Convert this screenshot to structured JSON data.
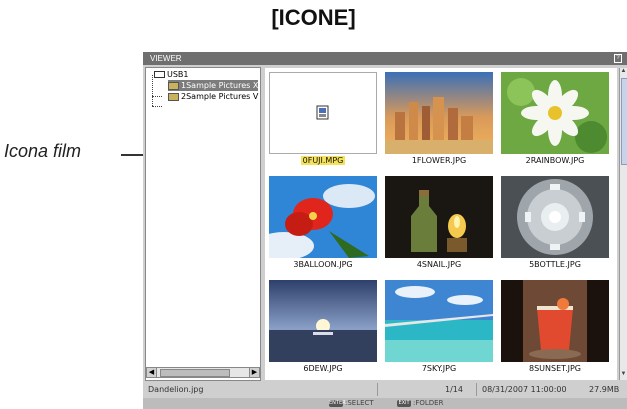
{
  "heading": "[ICONE]",
  "callout": "Icona film",
  "window": {
    "title": "VIEWER",
    "title_icon": "help-icon"
  },
  "tree": {
    "root": "USB1",
    "folders": [
      {
        "label": "1Sample Pictures X",
        "selected": true
      },
      {
        "label": "2Sample Pictures V",
        "selected": false
      }
    ]
  },
  "files": [
    {
      "name": "0FUJI.MPG",
      "kind": "movie",
      "selected": true
    },
    {
      "name": "1FLOWER.JPG",
      "kind": "city-skyline"
    },
    {
      "name": "2RAINBOW.JPG",
      "kind": "white-flower"
    },
    {
      "name": "3BALLOON.JPG",
      "kind": "red-flower-sky"
    },
    {
      "name": "4SNAIL.JPG",
      "kind": "bottle-lamp"
    },
    {
      "name": "5BOTTLE.JPG",
      "kind": "dome"
    },
    {
      "name": "6DEW.JPG",
      "kind": "sunset-sea"
    },
    {
      "name": "7SKY.JPG",
      "kind": "bridge-sea"
    },
    {
      "name": "8SUNSET.JPG",
      "kind": "drink-glass"
    }
  ],
  "status": {
    "filename": "Dandelion.jpg",
    "count": "1/14",
    "datetime": "08/31/2007 11:00:00",
    "size": "27.9MB"
  },
  "keys": [
    {
      "key": "ENTER",
      "label": ":SELECT"
    },
    {
      "key": "EXIT",
      "label": ":FOLDER"
    }
  ]
}
